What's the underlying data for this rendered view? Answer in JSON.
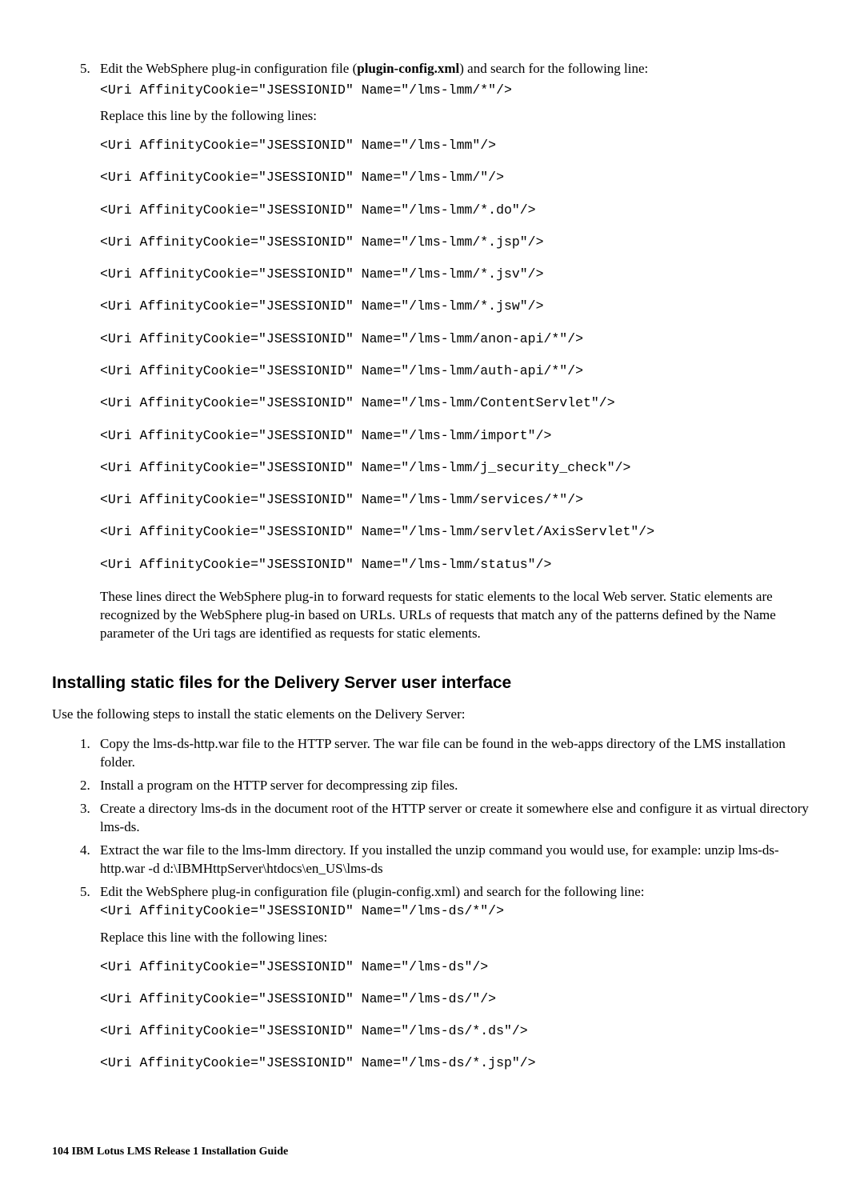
{
  "section1": {
    "step5": {
      "marker": "5.",
      "intro_pre": "Edit the WebSphere plug-in configuration file (",
      "intro_bold": "plugin-config.xml",
      "intro_post": ") and search for the following line:",
      "find_line": "<Uri AffinityCookie=\"JSESSIONID\" Name=\"/lms-lmm/*\"/>",
      "replace_intro": "Replace this line by the following lines:",
      "replace_lines": [
        "<Uri AffinityCookie=\"JSESSIONID\" Name=\"/lms-lmm\"/>",
        "<Uri AffinityCookie=\"JSESSIONID\" Name=\"/lms-lmm/\"/>",
        "<Uri AffinityCookie=\"JSESSIONID\" Name=\"/lms-lmm/*.do\"/>",
        "<Uri AffinityCookie=\"JSESSIONID\" Name=\"/lms-lmm/*.jsp\"/>",
        "<Uri AffinityCookie=\"JSESSIONID\" Name=\"/lms-lmm/*.jsv\"/>",
        "<Uri AffinityCookie=\"JSESSIONID\" Name=\"/lms-lmm/*.jsw\"/>",
        "<Uri AffinityCookie=\"JSESSIONID\" Name=\"/lms-lmm/anon-api/*\"/>",
        "<Uri AffinityCookie=\"JSESSIONID\" Name=\"/lms-lmm/auth-api/*\"/>",
        "<Uri AffinityCookie=\"JSESSIONID\" Name=\"/lms-lmm/ContentServlet\"/>",
        "<Uri AffinityCookie=\"JSESSIONID\" Name=\"/lms-lmm/import\"/>",
        "<Uri AffinityCookie=\"JSESSIONID\" Name=\"/lms-lmm/j_security_check\"/>",
        "<Uri AffinityCookie=\"JSESSIONID\" Name=\"/lms-lmm/services/*\"/>",
        "<Uri AffinityCookie=\"JSESSIONID\" Name=\"/lms-lmm/servlet/AxisServlet\"/>",
        "<Uri AffinityCookie=\"JSESSIONID\" Name=\"/lms-lmm/status\"/>"
      ],
      "closing": "These lines direct the WebSphere plug-in to forward requests for static elements to the local Web server. Static elements are recognized by the WebSphere plug-in based on URLs. URLs of requests that match any of the patterns defined by the Name parameter of the Uri tags are identified as requests for static elements."
    }
  },
  "section2": {
    "title": "Installing static files for the Delivery Server user interface",
    "intro": "Use the following steps to install the static elements on the Delivery Server:",
    "steps": [
      "Copy the lms-ds-http.war file to the HTTP server. The war file can be found in the web-apps directory of the LMS installation folder.",
      " Install a program on the HTTP server for decompressing zip files.",
      " Create a directory lms-ds in the document root of the HTTP server or create it somewhere else and configure it as virtual directory lms-ds.",
      "Extract the war file to the lms-lmm directory. If you installed the unzip command you would use, for example: unzip lms-ds-http.war -d d:\\IBMHttpServer\\htdocs\\en_US\\lms-ds"
    ],
    "step5": {
      "intro": "Edit the WebSphere plug-in configuration file (plugin-config.xml) and search for the following line:",
      "find_line": "<Uri AffinityCookie=\"JSESSIONID\" Name=\"/lms-ds/*\"/>",
      "replace_intro": "Replace this line with the following lines:",
      "replace_lines": [
        "<Uri AffinityCookie=\"JSESSIONID\" Name=\"/lms-ds\"/>",
        "<Uri AffinityCookie=\"JSESSIONID\" Name=\"/lms-ds/\"/>",
        "<Uri AffinityCookie=\"JSESSIONID\" Name=\"/lms-ds/*.ds\"/>",
        "<Uri AffinityCookie=\"JSESSIONID\" Name=\"/lms-ds/*.jsp\"/>"
      ]
    }
  },
  "footer": {
    "page_num": "104",
    "book": "IBM Lotus LMS Release 1 Installation Guide"
  }
}
